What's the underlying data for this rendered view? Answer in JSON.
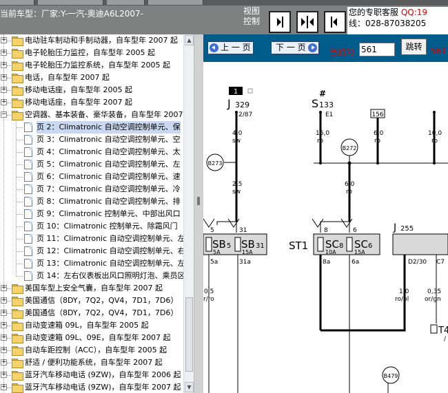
{
  "header": {
    "car_label": "当前车型：厂家:Y-一汽-奥迪A6L2007-",
    "view_label": "视图控制",
    "service_text": "您的专职客服",
    "qq_text": "QQ:19",
    "phone_text": "线：028-87038205"
  },
  "tree": {
    "items": [
      {
        "label": "电动驻车制动和手制动器，自车型年 2007 起",
        "type": "folder",
        "expanded": false
      },
      {
        "label": "电子轮胎压力监控，自车型年 2005 起",
        "type": "folder",
        "expanded": false
      },
      {
        "label": "电子轮胎压力监控系统，自车型年 2005 起",
        "type": "folder",
        "expanded": false
      },
      {
        "label": "电话，自车型年 2007 起",
        "type": "folder",
        "expanded": false
      },
      {
        "label": "移动电话座，自车型年 2005 起",
        "type": "folder",
        "expanded": false
      },
      {
        "label": "移动电话座，自车型年 2007 起",
        "type": "folder",
        "expanded": false
      },
      {
        "label": "空调器、基本装备、豪华装备，自车型年 2007",
        "type": "folder",
        "expanded": true
      },
      {
        "label": "页 2：Climatronic 自动空调控制单元、保",
        "type": "page",
        "selected": true
      },
      {
        "label": "页 3：Climatronic 自动空调控制单元、空",
        "type": "page"
      },
      {
        "label": "页 4：Climatronic 自动空调控制单元、太",
        "type": "page"
      },
      {
        "label": "页 5：Climatronic 自动空调控制单元、左",
        "type": "page"
      },
      {
        "label": "页 6：Climatronic 自动空调控制单元、速",
        "type": "page"
      },
      {
        "label": "页 7：Climatronic 自动空调控制单元、冷",
        "type": "page"
      },
      {
        "label": "页 8：Climatronic 自动空调控制单元、排",
        "type": "page"
      },
      {
        "label": "页 9：Climatronic 控制单元、中部出风口",
        "type": "page"
      },
      {
        "label": "页 10：Climatronic 控制单元、除霜风门",
        "type": "page"
      },
      {
        "label": "页 11：Climatronic 自动空调控制单元、左",
        "type": "page"
      },
      {
        "label": "页 12：Climatronic 自动空调控制单元、右",
        "type": "page"
      },
      {
        "label": "页 13：Climatronic 自动空调控制单元、左",
        "type": "page"
      },
      {
        "label": "页 14：左右仪表板出风口照明灯泡、乘员区",
        "type": "page"
      },
      {
        "label": "美国车型上安全气囊，自车型年 2007 起",
        "type": "folder",
        "expanded": false
      },
      {
        "label": "美国通信（8DY，7Q2，QV4，7D1，7D6）",
        "type": "folder",
        "expanded": false
      },
      {
        "label": "美国通信（8DY，7Q2，QV4，7D1，7D6）",
        "type": "folder",
        "expanded": false
      },
      {
        "label": "自动变速箱 09L，自车型年 2005 起",
        "type": "folder",
        "expanded": false
      },
      {
        "label": "自动变速箱 09L、09E，自车型年 2007 起",
        "type": "folder",
        "expanded": false
      },
      {
        "label": "自动车距控制（ACC），自车型年 2005 起",
        "type": "folder",
        "expanded": false
      },
      {
        "label": "舒适 / 便利功能系统，自车型年 2007 起",
        "type": "folder",
        "expanded": false
      },
      {
        "label": "蓝牙汽车移动电话 (9ZW)，自车型年 2006 起",
        "type": "folder",
        "expanded": false
      },
      {
        "label": "蓝牙汽车移动电话 (9ZW)，自车型年 2007 起",
        "type": "folder",
        "expanded": false
      }
    ]
  },
  "pager": {
    "prev_label": "上 一 页",
    "next_label": "下 一 页",
    "current_label": "当前为",
    "current_value": "561",
    "jump_label": "跳转",
    "total_label": "561"
  },
  "diagram": {
    "labels": {
      "j329": "J",
      "j329_sub": "329",
      "s133": "S",
      "s133_sub": "133",
      "hash": "#",
      "box1": "1",
      "w287": "2/87",
      "e1": "E1",
      "box156": "156",
      "wire40": "4,0",
      "sw1": "sw",
      "wire160": "16,0",
      "ro1": "ro",
      "wire60a": "6,0",
      "ro2": "ro",
      "wire100": "10,0",
      "ro3": "ro",
      "b273": "B273",
      "b272": "B272",
      "wire25": "2,5",
      "sw2": "sw",
      "wire60b": "6,0",
      "ro4": "ro",
      "p5": "5",
      "p31": "31",
      "p8": "8",
      "p6": "6",
      "j255": "J",
      "j255_sub": "255",
      "st1": "ST1",
      "sb5": "SB",
      "sb5_sub": "5",
      "sb5_amp": "5A",
      "sb31": "SB",
      "sb31_sub": "31",
      "sb31_amp": "15A",
      "sc8": "SC",
      "sc8_sub": "8",
      "sc8_amp": "10A",
      "sc6": "SC",
      "sc6_sub": "6",
      "sc6_amp": "15A",
      "p5a": "5a",
      "p31a": "31a",
      "p8a": "8a",
      "p6a": "6a",
      "d230": "D2/30",
      "c7": "C7",
      "wire05": "0,5",
      "rro": "r/ro",
      "wire10": "1,0",
      "robl": "ro/bl",
      "wire035": "0,35",
      "orgn": "or/gn",
      "t4": "T4",
      "t4_tail": "/",
      "b479": "B479"
    }
  }
}
